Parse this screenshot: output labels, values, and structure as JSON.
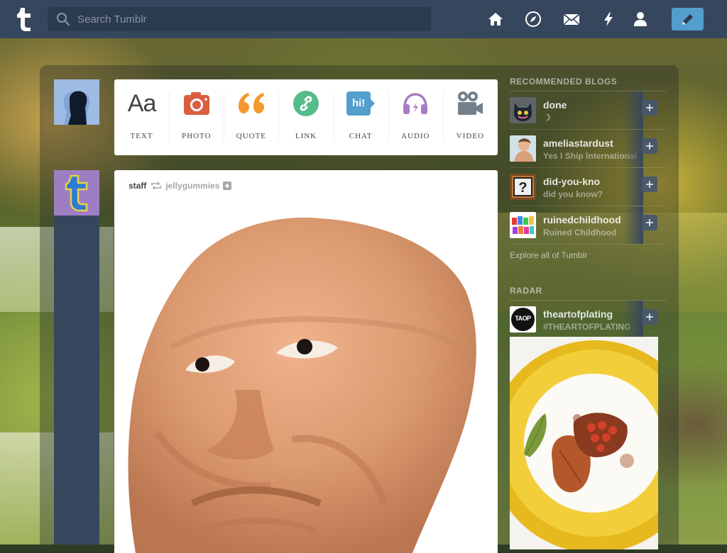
{
  "topbar": {
    "search_placeholder": "Search Tumblr",
    "nav_icons": [
      "home-icon",
      "explore-compass-icon",
      "inbox-mail-icon",
      "activity-lightning-icon",
      "account-person-icon"
    ],
    "compose_icon": "pencil-icon",
    "colors": {
      "bar": "#36465d",
      "compose": "#529ecc"
    }
  },
  "post_types": [
    {
      "label": "TEXT",
      "icon": "text-aa-icon",
      "color": "#444444"
    },
    {
      "label": "PHOTO",
      "icon": "camera-icon",
      "color": "#d95e40"
    },
    {
      "label": "QUOTE",
      "icon": "quote-icon",
      "color": "#f2992e"
    },
    {
      "label": "LINK",
      "icon": "link-icon",
      "color": "#56bc8a"
    },
    {
      "label": "CHAT",
      "icon": "chat-icon",
      "color": "#529ecc",
      "icon_text": "hi!"
    },
    {
      "label": "AUDIO",
      "icon": "headphones-icon",
      "color": "#a77dc2"
    },
    {
      "label": "VIDEO",
      "icon": "video-camera-icon",
      "color": "#748089"
    }
  ],
  "post": {
    "author": "staff",
    "reblogged_from": "jellygummies"
  },
  "sidebar": {
    "recommended_heading": "RECOMMENDED BLOGS",
    "blogs": [
      {
        "name": "done",
        "subtitle": "☽"
      },
      {
        "name": "ameliastardust",
        "subtitle": "Yes I Ship International"
      },
      {
        "name": "did-you-kno",
        "subtitle": "did you know?"
      },
      {
        "name": "ruinedchildhood",
        "subtitle": "Ruined Childhood"
      }
    ],
    "explore_link": "Explore all of Tumblr",
    "radar_heading": "RADAR",
    "radar_blog": {
      "name": "theartofplating",
      "subtitle": "#THEARTOFPLATING",
      "avatar_text": "TAOP"
    }
  }
}
